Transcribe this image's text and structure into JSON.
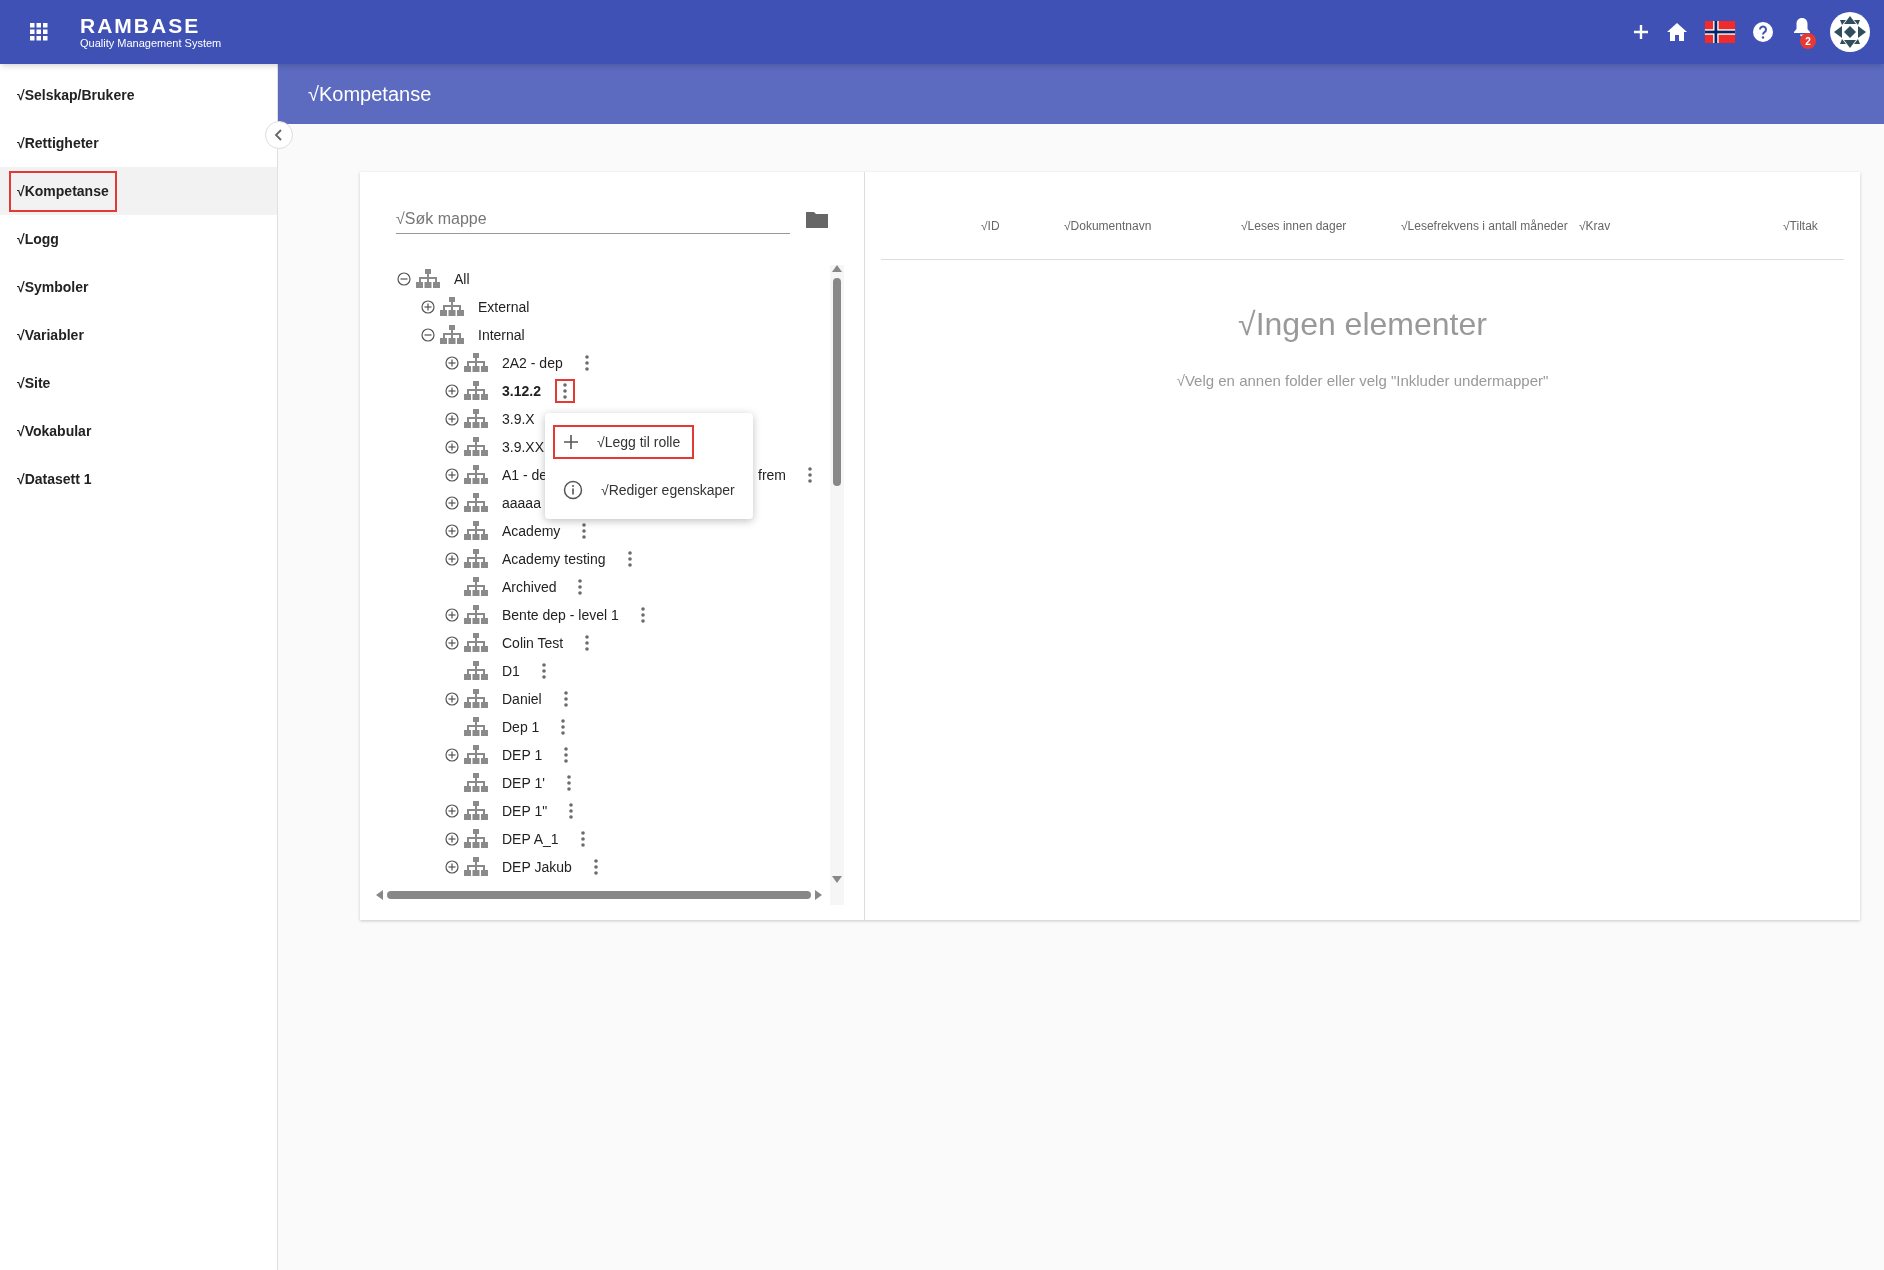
{
  "header": {
    "logo_title": "RAMBASE",
    "logo_subtitle": "Quality Management System",
    "notification_count": "2"
  },
  "sidebar": {
    "items": [
      {
        "label": "√Selskap/Brukere",
        "selected": false,
        "highlighted": false
      },
      {
        "label": "√Rettigheter",
        "selected": false,
        "highlighted": false
      },
      {
        "label": "√Kompetanse",
        "selected": true,
        "highlighted": true
      },
      {
        "label": "√Logg",
        "selected": false,
        "highlighted": false
      },
      {
        "label": "√Symboler",
        "selected": false,
        "highlighted": false
      },
      {
        "label": "√Variabler",
        "selected": false,
        "highlighted": false
      },
      {
        "label": "√Site",
        "selected": false,
        "highlighted": false
      },
      {
        "label": "√Vokabular",
        "selected": false,
        "highlighted": false
      },
      {
        "label": "√Datasett 1",
        "selected": false,
        "highlighted": false
      }
    ]
  },
  "page_title": "√Kompetanse",
  "search": {
    "placeholder": "√Søk mappe"
  },
  "tree": [
    {
      "label": "All",
      "has_children": true,
      "expanded": true,
      "selected": false,
      "menu": false,
      "children": [
        {
          "label": "External",
          "has_children": true,
          "expanded": false,
          "selected": false,
          "menu": false
        },
        {
          "label": "Internal",
          "has_children": true,
          "expanded": true,
          "selected": false,
          "menu": false,
          "children": [
            {
              "label": "2A2 - dep",
              "has_children": true,
              "expanded": false,
              "selected": false,
              "menu": true,
              "menu_highlighted": false
            },
            {
              "label": "3.12.2",
              "has_children": true,
              "expanded": false,
              "selected": true,
              "menu": true,
              "menu_highlighted": true
            },
            {
              "label": "3.9.X",
              "has_children": true,
              "expanded": false,
              "selected": false,
              "menu": false
            },
            {
              "label": "3.9.XX",
              "has_children": true,
              "expanded": false,
              "selected": false,
              "menu": false
            },
            {
              "label": "A1 - de",
              "label_end": "frem",
              "has_children": true,
              "expanded": false,
              "selected": false,
              "menu": true,
              "menu_highlighted": false
            },
            {
              "label": "aaaaa",
              "has_children": true,
              "expanded": false,
              "selected": false,
              "menu": false
            },
            {
              "label": "Academy",
              "has_children": true,
              "expanded": false,
              "selected": false,
              "menu": true,
              "menu_highlighted": false
            },
            {
              "label": "Academy testing",
              "has_children": true,
              "expanded": false,
              "selected": false,
              "menu": true,
              "menu_highlighted": false
            },
            {
              "label": "Archived",
              "has_children": false,
              "selected": false,
              "menu": true,
              "menu_highlighted": false
            },
            {
              "label": "Bente dep - level 1",
              "has_children": true,
              "expanded": false,
              "selected": false,
              "menu": true,
              "menu_highlighted": false
            },
            {
              "label": "Colin Test",
              "has_children": true,
              "expanded": false,
              "selected": false,
              "menu": true,
              "menu_highlighted": false
            },
            {
              "label": "D1",
              "has_children": false,
              "selected": false,
              "menu": true,
              "menu_highlighted": false
            },
            {
              "label": "Daniel",
              "has_children": true,
              "expanded": false,
              "selected": false,
              "menu": true,
              "menu_highlighted": false
            },
            {
              "label": "Dep 1",
              "has_children": false,
              "selected": false,
              "menu": true,
              "menu_highlighted": false
            },
            {
              "label": "DEP 1",
              "has_children": true,
              "expanded": false,
              "selected": false,
              "menu": true,
              "menu_highlighted": false
            },
            {
              "label": "DEP 1'",
              "has_children": false,
              "selected": false,
              "menu": true,
              "menu_highlighted": false
            },
            {
              "label": "DEP 1\"",
              "has_children": true,
              "expanded": false,
              "selected": false,
              "menu": true,
              "menu_highlighted": false
            },
            {
              "label": "DEP A_1",
              "has_children": true,
              "expanded": false,
              "selected": false,
              "menu": true,
              "menu_highlighted": false
            },
            {
              "label": "DEP Jakub",
              "has_children": true,
              "expanded": false,
              "selected": false,
              "menu": true,
              "menu_highlighted": false
            }
          ]
        }
      ]
    }
  ],
  "context_menu": [
    {
      "kind": "plus",
      "label": "√Legg til rolle",
      "highlighted": true
    },
    {
      "kind": "info",
      "label": "√Rediger egenskaper",
      "highlighted": false
    }
  ],
  "table": {
    "columns": [
      "√ID",
      "√Dokumentnavn",
      "√Leses innen dager",
      "√Lesefrekvens i antall måneder",
      "√Krav",
      "√Tiltak"
    ]
  },
  "empty_state": {
    "title": "√Ingen elementer",
    "message": "√Velg en annen folder eller velg \"Inkluder undermapper\""
  }
}
